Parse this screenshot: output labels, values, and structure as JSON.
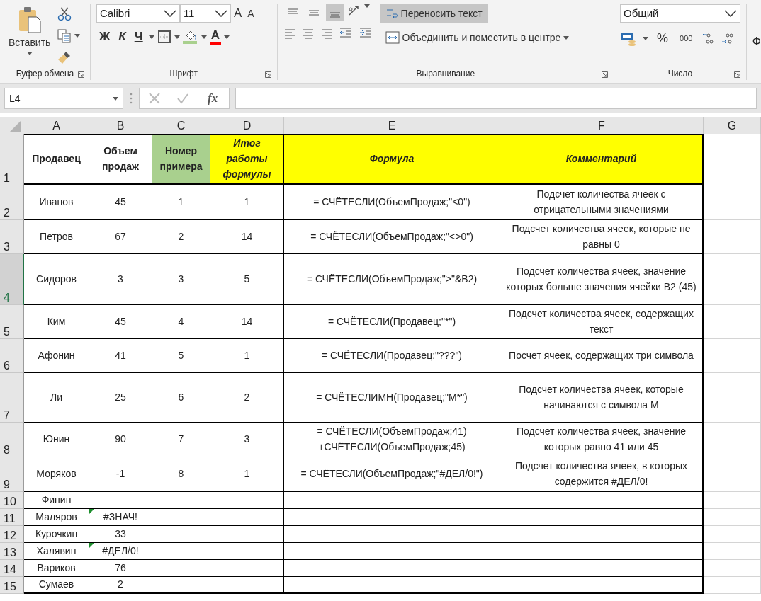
{
  "clipboard": {
    "label": "Буфер обмена",
    "paste": "Вставить"
  },
  "font": {
    "label": "Шрифт",
    "name": "Calibri",
    "size": "11",
    "grow": "A",
    "shrink": "A",
    "bold": "Ж",
    "italic": "К",
    "underline": "Ч",
    "font_color": "A"
  },
  "alignment": {
    "label": "Выравнивание",
    "vertical": [
      {
        "selected": false
      },
      {
        "selected": false
      },
      {
        "selected": true
      }
    ],
    "wrap_text": {
      "label": "Переносить текст",
      "selected": true
    },
    "merge": "Объединить и поместить в центре"
  },
  "number": {
    "label": "Число",
    "format": "Общий",
    "percent": "%",
    "thousands": "000"
  },
  "next_group": "Ф",
  "name_box": "L4",
  "fx": "fx",
  "columns": [
    "A",
    "B",
    "C",
    "D",
    "E",
    "F",
    "G"
  ],
  "rows": [
    {
      "number": "1",
      "selected": false,
      "kind": "header",
      "cells": [
        {
          "text": "Продавец",
          "color": "#ffffff",
          "italic": false
        },
        {
          "text": "Объем продаж",
          "color": "#ffffff",
          "italic": false
        },
        {
          "text": "Номер примера",
          "color": "#a9d08e",
          "italic": false
        },
        {
          "text": "Итог работы формулы",
          "color": "#ffff00",
          "italic": true
        },
        {
          "text": "Формула",
          "color": "#ffff00",
          "italic": true
        },
        {
          "text": "Комментарий",
          "color": "#ffff00",
          "italic": true
        }
      ]
    },
    {
      "number": "2",
      "selected": false,
      "kind": "data",
      "cells": [
        {
          "text": "Иванов"
        },
        {
          "text": "45"
        },
        {
          "text": "1"
        },
        {
          "text": "1"
        },
        {
          "text": "= СЧЁТЕСЛИ(ОбъемПродаж;\"<0\")"
        },
        {
          "text": "Подсчет количества ячеек с отрицательными значениями"
        }
      ]
    },
    {
      "number": "3",
      "selected": false,
      "kind": "data",
      "cells": [
        {
          "text": "Петров"
        },
        {
          "text": "67"
        },
        {
          "text": "2"
        },
        {
          "text": "14"
        },
        {
          "text": "= СЧЁТЕСЛИ(ОбъемПродаж;\"<>0\")"
        },
        {
          "text": "Подсчет количества ячеек, которые не равны 0"
        }
      ]
    },
    {
      "number": "4",
      "selected": true,
      "kind": "data",
      "cells": [
        {
          "text": "Сидоров"
        },
        {
          "text": "3"
        },
        {
          "text": "3"
        },
        {
          "text": "5"
        },
        {
          "text": "= СЧЁТЕСЛИ(ОбъемПродаж;\">\"&B2)"
        },
        {
          "text": "Подсчет количества ячеек, значение которых больше значения ячейки B2 (45)"
        }
      ]
    },
    {
      "number": "5",
      "selected": false,
      "kind": "data",
      "cells": [
        {
          "text": "Ким"
        },
        {
          "text": "45"
        },
        {
          "text": "4"
        },
        {
          "text": "14"
        },
        {
          "text": "= СЧЁТЕСЛИ(Продавец;\"*\")"
        },
        {
          "text": "Подсчет количества ячеек, содержащих текст"
        }
      ]
    },
    {
      "number": "6",
      "selected": false,
      "kind": "data",
      "cells": [
        {
          "text": "Афонин"
        },
        {
          "text": "41"
        },
        {
          "text": "5"
        },
        {
          "text": "1"
        },
        {
          "text": "= СЧЁТЕСЛИ(Продавец;\"???\")"
        },
        {
          "text": "Посчет ячеек, содержащих три символа"
        }
      ]
    },
    {
      "number": "7",
      "selected": false,
      "kind": "data",
      "cells": [
        {
          "text": "Ли"
        },
        {
          "text": "25"
        },
        {
          "text": "6"
        },
        {
          "text": "2"
        },
        {
          "text": "= СЧЁТЕСЛИМН(Продавец;\"М*\")"
        },
        {
          "text": "Подсчет количества ячеек, которые начинаются с символа М"
        }
      ]
    },
    {
      "number": "8",
      "selected": false,
      "kind": "data",
      "cells": [
        {
          "text": "Юнин"
        },
        {
          "text": "90"
        },
        {
          "text": "7"
        },
        {
          "text": "3"
        },
        {
          "text": "= СЧЁТЕСЛИ(ОбъемПродаж;41) +СЧЁТЕСЛИ(ОбъемПродаж;45)"
        },
        {
          "text": "Подсчет количества ячеек, значение которых равно 41 или 45"
        }
      ]
    },
    {
      "number": "9",
      "selected": false,
      "kind": "data",
      "cells": [
        {
          "text": "Моряков"
        },
        {
          "text": "-1"
        },
        {
          "text": "8"
        },
        {
          "text": "1"
        },
        {
          "text": "= СЧЁТЕСЛИ(ОбъемПродаж;\"#ДЕЛ/0!\")"
        },
        {
          "text": "Подсчет количества ячеек, в которых содержится #ДЕЛ/0!"
        }
      ]
    },
    {
      "number": "10",
      "selected": false,
      "kind": "data",
      "cells": [
        {
          "text": "Финин"
        }
      ]
    },
    {
      "number": "11",
      "selected": false,
      "kind": "data",
      "cells": [
        {
          "text": "Маляров"
        },
        {
          "text": "#ЗНАЧ!",
          "error_flag": true
        }
      ]
    },
    {
      "number": "12",
      "selected": false,
      "kind": "data",
      "cells": [
        {
          "text": "Курочкин"
        },
        {
          "text": "33"
        }
      ]
    },
    {
      "number": "13",
      "selected": false,
      "kind": "data",
      "cells": [
        {
          "text": "Халявин"
        },
        {
          "text": "#ДЕЛ/0!",
          "error_flag": true
        }
      ]
    },
    {
      "number": "14",
      "selected": false,
      "kind": "data",
      "cells": [
        {
          "text": "Вариков"
        },
        {
          "text": "76"
        }
      ]
    },
    {
      "number": "15",
      "selected": false,
      "kind": "data",
      "cells": [
        {
          "text": "Сумаев"
        },
        {
          "text": "2"
        }
      ]
    }
  ]
}
